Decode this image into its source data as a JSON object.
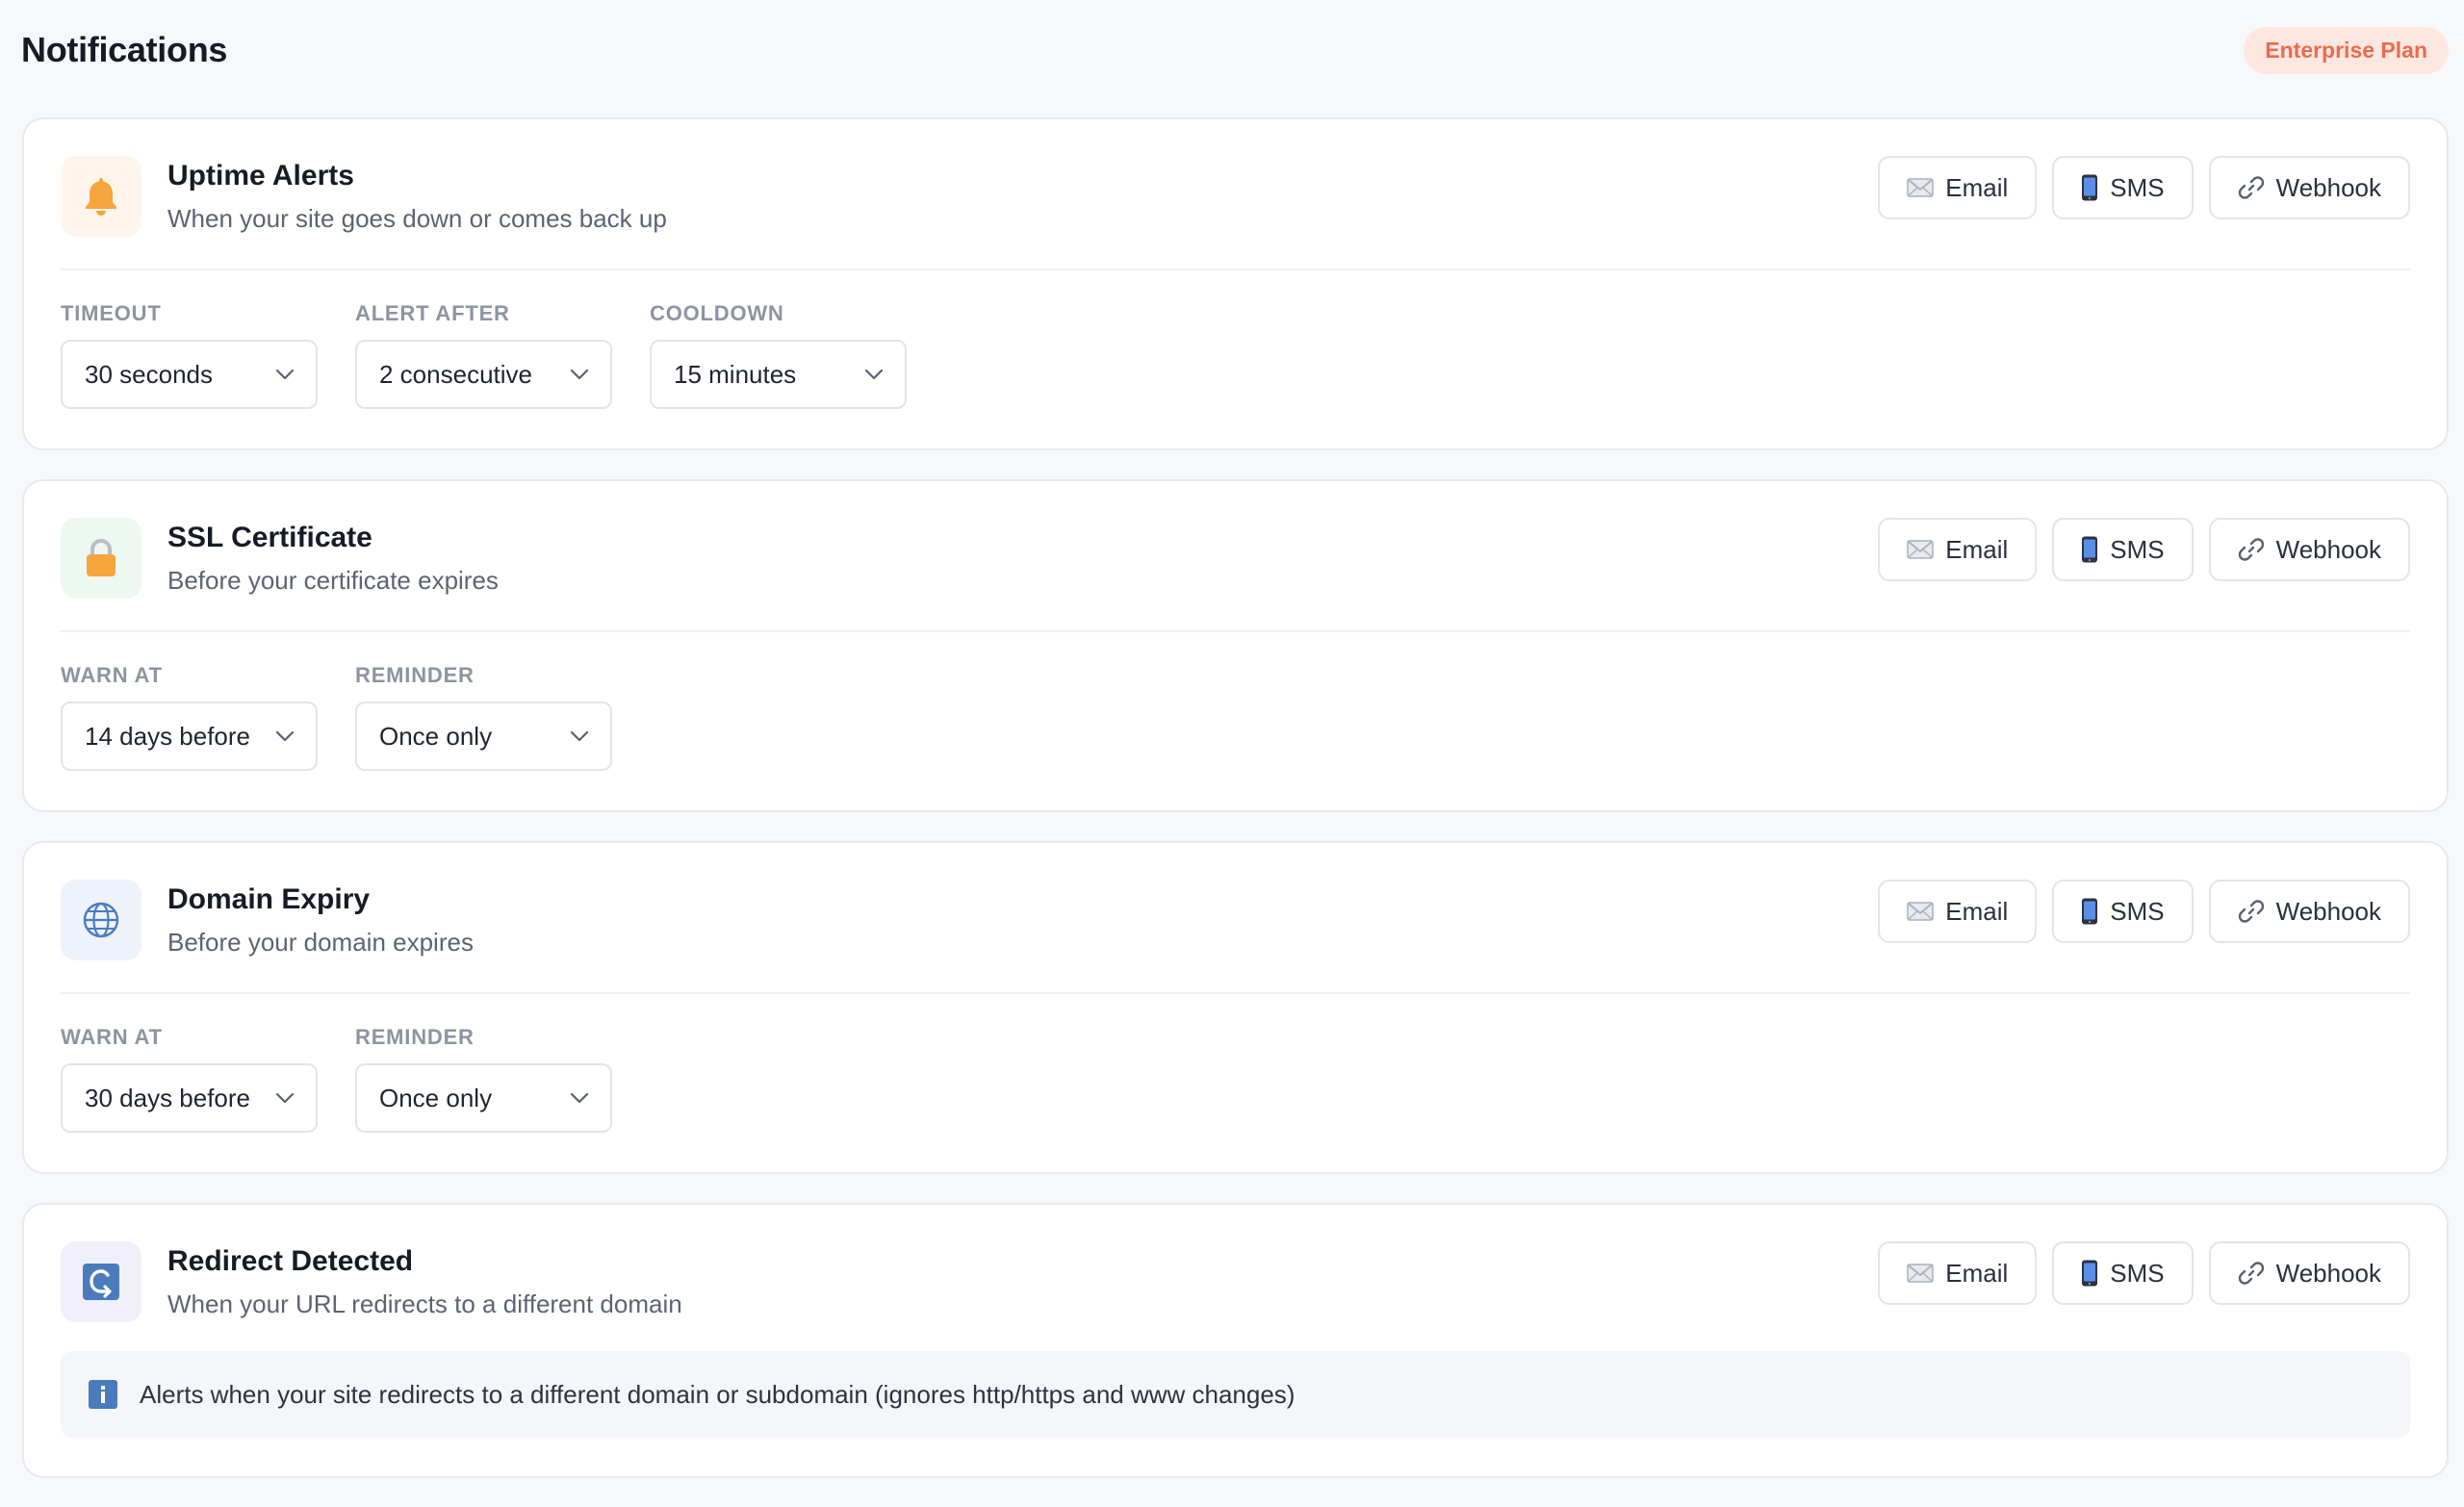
{
  "header": {
    "title": "Notifications",
    "plan_badge": "Enterprise Plan"
  },
  "channels": {
    "email": "Email",
    "sms": "SMS",
    "webhook": "Webhook"
  },
  "cards": [
    {
      "title": "Uptime Alerts",
      "description": "When your site goes down or comes back up",
      "icon": "bell-icon",
      "fields": [
        {
          "label": "TIMEOUT",
          "value": "30 seconds"
        },
        {
          "label": "ALERT AFTER",
          "value": "2 consecutive"
        },
        {
          "label": "COOLDOWN",
          "value": "15 minutes"
        }
      ]
    },
    {
      "title": "SSL Certificate",
      "description": "Before your certificate expires",
      "icon": "lock-icon",
      "fields": [
        {
          "label": "WARN AT",
          "value": "14 days before"
        },
        {
          "label": "REMINDER",
          "value": "Once only"
        }
      ]
    },
    {
      "title": "Domain Expiry",
      "description": "Before your domain expires",
      "icon": "globe-icon",
      "fields": [
        {
          "label": "WARN AT",
          "value": "30 days before"
        },
        {
          "label": "REMINDER",
          "value": "Once only"
        }
      ]
    },
    {
      "title": "Redirect Detected",
      "description": "When your URL redirects to a different domain",
      "icon": "redirect-icon",
      "info": "Alerts when your site redirects to a different domain or subdomain (ignores http/https and www changes)"
    }
  ],
  "colors": {
    "badge_bg": "#fde7e1",
    "badge_text": "#ea6c4c",
    "icon_orange": "#f4a53c",
    "icon_blue": "#4a7bbd"
  }
}
